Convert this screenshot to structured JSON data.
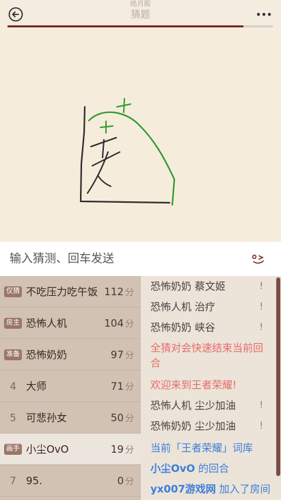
{
  "header": {
    "subtitle": "皓月殿",
    "title": "猜题",
    "progress_percent": 89
  },
  "input": {
    "placeholder": "输入猜测、回车发送"
  },
  "players": [
    {
      "rank": "",
      "badge": "仅猜",
      "name": "不吃压力吃午饭",
      "score": "112",
      "unit": "分",
      "active": false
    },
    {
      "rank": "",
      "badge": "房主",
      "name": "恐怖人机",
      "score": "104",
      "unit": "分",
      "active": false
    },
    {
      "rank": "",
      "badge": "准备",
      "name": "恐怖奶奶",
      "score": "97",
      "unit": "分",
      "active": false
    },
    {
      "rank": "4",
      "badge": "",
      "name": "大师",
      "score": "71",
      "unit": "分",
      "active": false
    },
    {
      "rank": "5",
      "badge": "",
      "name": "可悲孙女",
      "score": "50",
      "unit": "分",
      "active": false
    },
    {
      "rank": "",
      "badge": "画手",
      "name": "小尘OvO",
      "score": "19",
      "unit": "分",
      "active": true
    },
    {
      "rank": "7",
      "badge": "",
      "name": "95.",
      "score": "0",
      "unit": "分",
      "active": false
    }
  ],
  "chat": {
    "guesses": [
      {
        "user": "恐怖奶奶",
        "text": "蔡文姬",
        "mark": "!"
      },
      {
        "user": "恐怖人机",
        "text": "治疗",
        "mark": "!"
      },
      {
        "user": "恐怖奶奶",
        "text": "峡谷",
        "mark": "!"
      }
    ],
    "sys1": "全猜对会快速结束当前回合",
    "sys2": "欢迎来到王者荣耀!",
    "guesses2": [
      {
        "user": "恐怖人机",
        "text": "尘少加油",
        "mark": "!"
      },
      {
        "user": "恐怖奶奶",
        "text": "尘少加油",
        "mark": "!"
      }
    ],
    "info1": "当前「王者荣耀」词库",
    "info2_name": "小尘OvO",
    "info2_text": " 的回合",
    "info3_name": "yx007游戏网",
    "info3_text": " 加入了房间"
  },
  "colors": {
    "accent": "#7a2a24",
    "stroke_black": "#2b2b2b",
    "stroke_green": "#2e9a2e"
  }
}
